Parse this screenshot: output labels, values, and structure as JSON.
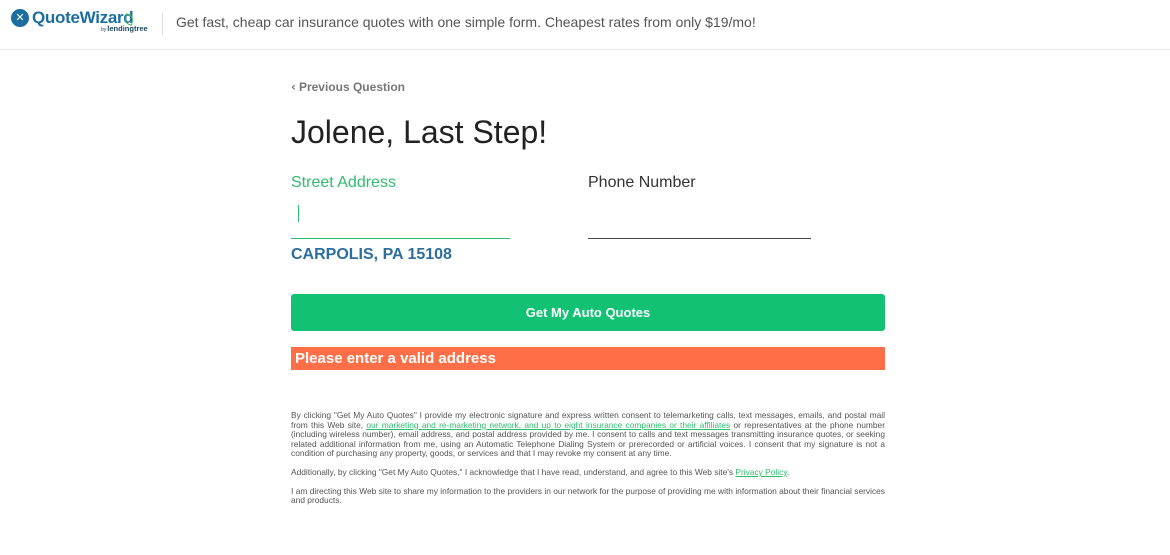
{
  "header": {
    "logo_text": "QuoteWizard",
    "logo_sub_by": "by",
    "logo_sub": "lendingtree",
    "tagline": "Get fast, cheap car insurance quotes with one simple form. Cheapest rates from only $19/mo!"
  },
  "nav": {
    "prev_label": "Previous Question"
  },
  "form": {
    "heading": "Jolene, Last Step!",
    "street_label": "Street Address",
    "street_value": "",
    "phone_label": "Phone Number",
    "phone_value": "",
    "city_line": "CARPOLIS, PA 15108",
    "submit_label": "Get My Auto Quotes",
    "error_message": "Please enter a valid address"
  },
  "legal": {
    "p1_a": "By clicking \"Get My Auto Quotes\" I provide my electronic signature and express written consent to telemarketing calls, text messages, emails, and postal mail from this Web site, ",
    "p1_link": "our marketing and re-marketing network, and up to eight insurance companies or their affiliates",
    "p1_b": " or representatives at the phone number (including wireless number), email address, and postal address provided by me. I consent to calls and text messages transmitting insurance quotes, or seeking related additional information from me, using an Automatic Telephone Dialing System or prerecorded or artificial voices. I consent that my signature is not a condition of purchasing any property, goods, or services and that I may revoke my consent at any time.",
    "p2_a": "Additionally, by clicking \"Get My Auto Quotes,\" I acknowledge that I have read, understand, and agree to this Web site's ",
    "p2_link": "Privacy Policy",
    "p2_b": ".",
    "p3": "I am directing this Web site to share my information to the providers in our network for the purpose of providing me with information about their financial services and products."
  }
}
